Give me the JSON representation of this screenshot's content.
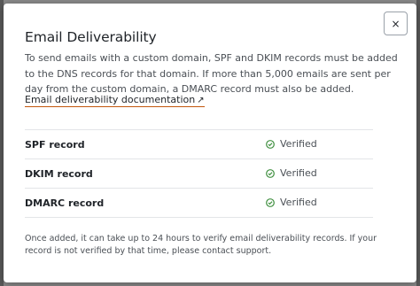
{
  "modal": {
    "title": "Email Deliverability",
    "close_label": "×",
    "description": "To send emails with a custom domain, SPF and DKIM records must be added to the DNS records for that domain. If more than 5,000 emails are sent per day from the custom domain, a DMARC record must also be added.",
    "doc_link": {
      "label": "Email deliverability documentation",
      "icon": "external-link-icon",
      "icon_glyph": "↗"
    },
    "records": [
      {
        "name": "SPF record",
        "status": "Verified",
        "status_icon": "check-circle-icon"
      },
      {
        "name": "DKIM record",
        "status": "Verified",
        "status_icon": "check-circle-icon"
      },
      {
        "name": "DMARC record",
        "status": "Verified",
        "status_icon": "check-circle-icon"
      }
    ],
    "footer_note": "Once added, it can take up to 24 hours to verify email deliverability records. If your record is not verified by that time, please contact support."
  },
  "colors": {
    "verified": "#3f8f3f",
    "link_underline": "#c2570c"
  }
}
